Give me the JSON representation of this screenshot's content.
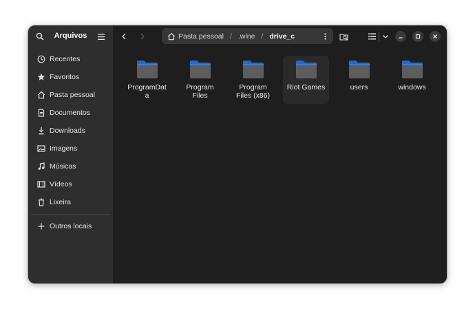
{
  "sidebar": {
    "title": "Arquivos",
    "items": [
      {
        "label": "Recentes",
        "icon": "clock-icon"
      },
      {
        "label": "Favoritos",
        "icon": "star-icon"
      },
      {
        "label": "Pasta pessoal",
        "icon": "home-icon"
      },
      {
        "label": "Documentos",
        "icon": "document-icon"
      },
      {
        "label": "Downloads",
        "icon": "download-icon"
      },
      {
        "label": "Imagens",
        "icon": "image-icon"
      },
      {
        "label": "Músicas",
        "icon": "music-icon"
      },
      {
        "label": "Vídeos",
        "icon": "video-icon"
      },
      {
        "label": "Lixeira",
        "icon": "trash-icon"
      }
    ],
    "other": {
      "label": "Outros locais",
      "icon": "plus-icon"
    }
  },
  "path": {
    "segments": [
      "Pasta pessoal",
      ".wine"
    ],
    "current": "drive_c",
    "separator": "/"
  },
  "files": [
    {
      "name": "ProgramData"
    },
    {
      "name": "Program Files"
    },
    {
      "name": "Program Files (x86)"
    },
    {
      "name": "Riot Games"
    },
    {
      "name": "users"
    },
    {
      "name": "windows"
    }
  ],
  "colors": {
    "sidebar_bg": "#2e2e2e",
    "main_bg": "#1e1e1e",
    "folder_tab": "#1f6ad8",
    "folder_body": "#5d5d5d"
  }
}
